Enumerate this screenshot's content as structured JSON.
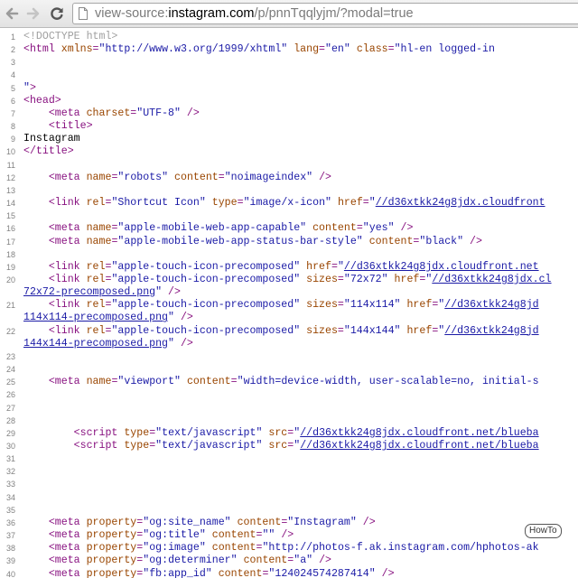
{
  "browser": {
    "url_prefix": "view-source:",
    "url_host": "instagram.com",
    "url_path": "/p/pnnTqqlyjm/?modal=true"
  },
  "source_lines": [
    {
      "n": "1",
      "segs": [
        {
          "t": "doctype",
          "v": "<!DOCTYPE html>"
        }
      ]
    },
    {
      "n": "2",
      "segs": [
        {
          "t": "tag",
          "v": "<html "
        },
        {
          "t": "attr",
          "v": "xmlns"
        },
        {
          "t": "tag",
          "v": "="
        },
        {
          "t": "val",
          "v": "\"http://www.w3.org/1999/xhtml\""
        },
        {
          "t": "attr",
          "v": " lang"
        },
        {
          "t": "tag",
          "v": "="
        },
        {
          "t": "val",
          "v": "\"en\""
        },
        {
          "t": "attr",
          "v": " class"
        },
        {
          "t": "tag",
          "v": "="
        },
        {
          "t": "val",
          "v": "\"hl-en logged-in"
        }
      ]
    },
    {
      "n": "3",
      "segs": []
    },
    {
      "n": "4",
      "segs": []
    },
    {
      "n": "5",
      "segs": [
        {
          "t": "val",
          "v": "\""
        },
        {
          "t": "tag",
          "v": ">"
        }
      ]
    },
    {
      "n": "6",
      "segs": [
        {
          "t": "tag",
          "v": "<head>"
        }
      ]
    },
    {
      "n": "7",
      "segs": [
        {
          "t": "txt",
          "v": "    "
        },
        {
          "t": "tag",
          "v": "<meta "
        },
        {
          "t": "attr",
          "v": "charset"
        },
        {
          "t": "tag",
          "v": "="
        },
        {
          "t": "val",
          "v": "\"UTF-8\""
        },
        {
          "t": "tag",
          "v": " />"
        }
      ]
    },
    {
      "n": "8",
      "segs": [
        {
          "t": "txt",
          "v": "    "
        },
        {
          "t": "tag",
          "v": "<title>"
        }
      ]
    },
    {
      "n": "9",
      "segs": [
        {
          "t": "txt",
          "v": "Instagram"
        }
      ]
    },
    {
      "n": "10",
      "segs": [
        {
          "t": "tag",
          "v": "</title>"
        }
      ]
    },
    {
      "n": "11",
      "segs": []
    },
    {
      "n": "12",
      "segs": [
        {
          "t": "txt",
          "v": "    "
        },
        {
          "t": "tag",
          "v": "<meta "
        },
        {
          "t": "attr",
          "v": "name"
        },
        {
          "t": "tag",
          "v": "="
        },
        {
          "t": "val",
          "v": "\"robots\""
        },
        {
          "t": "attr",
          "v": " content"
        },
        {
          "t": "tag",
          "v": "="
        },
        {
          "t": "val",
          "v": "\"noimageindex\""
        },
        {
          "t": "tag",
          "v": " />"
        }
      ]
    },
    {
      "n": "13",
      "segs": []
    },
    {
      "n": "14",
      "segs": [
        {
          "t": "txt",
          "v": "    "
        },
        {
          "t": "tag",
          "v": "<link "
        },
        {
          "t": "attr",
          "v": "rel"
        },
        {
          "t": "tag",
          "v": "="
        },
        {
          "t": "val",
          "v": "\"Shortcut Icon\""
        },
        {
          "t": "attr",
          "v": " type"
        },
        {
          "t": "tag",
          "v": "="
        },
        {
          "t": "val",
          "v": "\"image/x-icon\""
        },
        {
          "t": "attr",
          "v": " href"
        },
        {
          "t": "tag",
          "v": "="
        },
        {
          "t": "val",
          "v": "\""
        },
        {
          "t": "link",
          "v": "//d36xtkk24g8jdx.cloudfront"
        }
      ]
    },
    {
      "n": "15",
      "segs": []
    },
    {
      "n": "16",
      "segs": [
        {
          "t": "txt",
          "v": "    "
        },
        {
          "t": "tag",
          "v": "<meta "
        },
        {
          "t": "attr",
          "v": "name"
        },
        {
          "t": "tag",
          "v": "="
        },
        {
          "t": "val",
          "v": "\"apple-mobile-web-app-capable\""
        },
        {
          "t": "attr",
          "v": " content"
        },
        {
          "t": "tag",
          "v": "="
        },
        {
          "t": "val",
          "v": "\"yes\""
        },
        {
          "t": "tag",
          "v": " />"
        }
      ]
    },
    {
      "n": "17",
      "segs": [
        {
          "t": "txt",
          "v": "    "
        },
        {
          "t": "tag",
          "v": "<meta "
        },
        {
          "t": "attr",
          "v": "name"
        },
        {
          "t": "tag",
          "v": "="
        },
        {
          "t": "val",
          "v": "\"apple-mobile-web-app-status-bar-style\""
        },
        {
          "t": "attr",
          "v": " content"
        },
        {
          "t": "tag",
          "v": "="
        },
        {
          "t": "val",
          "v": "\"black\""
        },
        {
          "t": "tag",
          "v": " />"
        }
      ]
    },
    {
      "n": "18",
      "segs": []
    },
    {
      "n": "19",
      "segs": [
        {
          "t": "txt",
          "v": "    "
        },
        {
          "t": "tag",
          "v": "<link "
        },
        {
          "t": "attr",
          "v": "rel"
        },
        {
          "t": "tag",
          "v": "="
        },
        {
          "t": "val",
          "v": "\"apple-touch-icon-precomposed\""
        },
        {
          "t": "attr",
          "v": " href"
        },
        {
          "t": "tag",
          "v": "="
        },
        {
          "t": "val",
          "v": "\""
        },
        {
          "t": "link",
          "v": "//d36xtkk24g8jdx.cloudfront.net"
        }
      ]
    },
    {
      "n": "20",
      "segs": [
        {
          "t": "txt",
          "v": "    "
        },
        {
          "t": "tag",
          "v": "<link "
        },
        {
          "t": "attr",
          "v": "rel"
        },
        {
          "t": "tag",
          "v": "="
        },
        {
          "t": "val",
          "v": "\"apple-touch-icon-precomposed\""
        },
        {
          "t": "attr",
          "v": " sizes"
        },
        {
          "t": "tag",
          "v": "="
        },
        {
          "t": "val",
          "v": "\"72x72\""
        },
        {
          "t": "attr",
          "v": " href"
        },
        {
          "t": "tag",
          "v": "="
        },
        {
          "t": "val",
          "v": "\""
        },
        {
          "t": "link",
          "v": "//d36xtkk24g8jdx.cl"
        }
      ]
    },
    {
      "n": "",
      "segs": [
        {
          "t": "link",
          "v": "72x72-precomposed.png"
        },
        {
          "t": "val",
          "v": "\""
        },
        {
          "t": "tag",
          "v": " />"
        }
      ]
    },
    {
      "n": "21",
      "segs": [
        {
          "t": "txt",
          "v": "    "
        },
        {
          "t": "tag",
          "v": "<link "
        },
        {
          "t": "attr",
          "v": "rel"
        },
        {
          "t": "tag",
          "v": "="
        },
        {
          "t": "val",
          "v": "\"apple-touch-icon-precomposed\""
        },
        {
          "t": "attr",
          "v": " sizes"
        },
        {
          "t": "tag",
          "v": "="
        },
        {
          "t": "val",
          "v": "\"114x114\""
        },
        {
          "t": "attr",
          "v": " href"
        },
        {
          "t": "tag",
          "v": "="
        },
        {
          "t": "val",
          "v": "\""
        },
        {
          "t": "link",
          "v": "//d36xtkk24g8jd"
        }
      ]
    },
    {
      "n": "",
      "segs": [
        {
          "t": "link",
          "v": "114x114-precomposed.png"
        },
        {
          "t": "val",
          "v": "\""
        },
        {
          "t": "tag",
          "v": " />"
        }
      ]
    },
    {
      "n": "22",
      "segs": [
        {
          "t": "txt",
          "v": "    "
        },
        {
          "t": "tag",
          "v": "<link "
        },
        {
          "t": "attr",
          "v": "rel"
        },
        {
          "t": "tag",
          "v": "="
        },
        {
          "t": "val",
          "v": "\"apple-touch-icon-precomposed\""
        },
        {
          "t": "attr",
          "v": " sizes"
        },
        {
          "t": "tag",
          "v": "="
        },
        {
          "t": "val",
          "v": "\"144x144\""
        },
        {
          "t": "attr",
          "v": " href"
        },
        {
          "t": "tag",
          "v": "="
        },
        {
          "t": "val",
          "v": "\""
        },
        {
          "t": "link",
          "v": "//d36xtkk24g8jd"
        }
      ]
    },
    {
      "n": "",
      "segs": [
        {
          "t": "link",
          "v": "144x144-precomposed.png"
        },
        {
          "t": "val",
          "v": "\""
        },
        {
          "t": "tag",
          "v": " />"
        }
      ]
    },
    {
      "n": "23",
      "segs": []
    },
    {
      "n": "24",
      "segs": []
    },
    {
      "n": "25",
      "segs": [
        {
          "t": "txt",
          "v": "    "
        },
        {
          "t": "tag",
          "v": "<meta "
        },
        {
          "t": "attr",
          "v": "name"
        },
        {
          "t": "tag",
          "v": "="
        },
        {
          "t": "val",
          "v": "\"viewport\""
        },
        {
          "t": "attr",
          "v": " content"
        },
        {
          "t": "tag",
          "v": "="
        },
        {
          "t": "val",
          "v": "\"width=device-width, user-scalable=no, initial-s"
        }
      ]
    },
    {
      "n": "26",
      "segs": []
    },
    {
      "n": "27",
      "segs": []
    },
    {
      "n": "28",
      "segs": []
    },
    {
      "n": "29",
      "segs": [
        {
          "t": "txt",
          "v": "        "
        },
        {
          "t": "tag",
          "v": "<script "
        },
        {
          "t": "attr",
          "v": "type"
        },
        {
          "t": "tag",
          "v": "="
        },
        {
          "t": "val",
          "v": "\"text/javascript\""
        },
        {
          "t": "attr",
          "v": " src"
        },
        {
          "t": "tag",
          "v": "="
        },
        {
          "t": "val",
          "v": "\""
        },
        {
          "t": "link",
          "v": "//d36xtkk24g8jdx.cloudfront.net/blueba"
        }
      ]
    },
    {
      "n": "30",
      "segs": [
        {
          "t": "txt",
          "v": "        "
        },
        {
          "t": "tag",
          "v": "<script "
        },
        {
          "t": "attr",
          "v": "type"
        },
        {
          "t": "tag",
          "v": "="
        },
        {
          "t": "val",
          "v": "\"text/javascript\""
        },
        {
          "t": "attr",
          "v": " src"
        },
        {
          "t": "tag",
          "v": "="
        },
        {
          "t": "val",
          "v": "\""
        },
        {
          "t": "link",
          "v": "//d36xtkk24g8jdx.cloudfront.net/blueba"
        }
      ]
    },
    {
      "n": "31",
      "segs": []
    },
    {
      "n": "32",
      "segs": []
    },
    {
      "n": "33",
      "segs": []
    },
    {
      "n": "34",
      "segs": []
    },
    {
      "n": "35",
      "segs": []
    },
    {
      "n": "36",
      "segs": [
        {
          "t": "txt",
          "v": "    "
        },
        {
          "t": "tag",
          "v": "<meta "
        },
        {
          "t": "attr",
          "v": "property"
        },
        {
          "t": "tag",
          "v": "="
        },
        {
          "t": "val",
          "v": "\"og:site_name\""
        },
        {
          "t": "attr",
          "v": " content"
        },
        {
          "t": "tag",
          "v": "="
        },
        {
          "t": "val",
          "v": "\"Instagram\""
        },
        {
          "t": "tag",
          "v": " />"
        }
      ]
    },
    {
      "n": "37",
      "segs": [
        {
          "t": "txt",
          "v": "    "
        },
        {
          "t": "tag",
          "v": "<meta "
        },
        {
          "t": "attr",
          "v": "property"
        },
        {
          "t": "tag",
          "v": "="
        },
        {
          "t": "val",
          "v": "\"og:title\""
        },
        {
          "t": "attr",
          "v": " content"
        },
        {
          "t": "tag",
          "v": "="
        },
        {
          "t": "val",
          "v": "\"\""
        },
        {
          "t": "tag",
          "v": " />"
        }
      ]
    },
    {
      "n": "38",
      "segs": [
        {
          "t": "txt",
          "v": "    "
        },
        {
          "t": "tag",
          "v": "<meta "
        },
        {
          "t": "attr",
          "v": "property"
        },
        {
          "t": "tag",
          "v": "="
        },
        {
          "t": "val",
          "v": "\"og:image\""
        },
        {
          "t": "attr",
          "v": " content"
        },
        {
          "t": "tag",
          "v": "="
        },
        {
          "t": "val",
          "v": "\"http://photos-f.ak.instagram.com/hphotos-ak"
        }
      ]
    },
    {
      "n": "39",
      "segs": [
        {
          "t": "txt",
          "v": "    "
        },
        {
          "t": "tag",
          "v": "<meta "
        },
        {
          "t": "attr",
          "v": "property"
        },
        {
          "t": "tag",
          "v": "="
        },
        {
          "t": "val",
          "v": "\"og:determiner\""
        },
        {
          "t": "attr",
          "v": " content"
        },
        {
          "t": "tag",
          "v": "="
        },
        {
          "t": "val",
          "v": "\"a\""
        },
        {
          "t": "tag",
          "v": " />"
        }
      ]
    },
    {
      "n": "40",
      "segs": [
        {
          "t": "txt",
          "v": "    "
        },
        {
          "t": "tag",
          "v": "<meta "
        },
        {
          "t": "attr",
          "v": "property"
        },
        {
          "t": "tag",
          "v": "="
        },
        {
          "t": "val",
          "v": "\"fb:app_id\""
        },
        {
          "t": "attr",
          "v": " content"
        },
        {
          "t": "tag",
          "v": "="
        },
        {
          "t": "val",
          "v": "\"124024574287414\""
        },
        {
          "t": "tag",
          "v": " />"
        }
      ]
    }
  ],
  "watermark_text": "HowTo",
  "colors": {
    "tag": "#881280",
    "attribute": "#994500",
    "value": "#1a1aa6",
    "doctype": "#a0a0a0",
    "line_number": "#828282"
  },
  "icons": {
    "back": "arrow-left-icon",
    "forward": "arrow-right-icon",
    "reload": "reload-icon",
    "page": "page-icon"
  }
}
